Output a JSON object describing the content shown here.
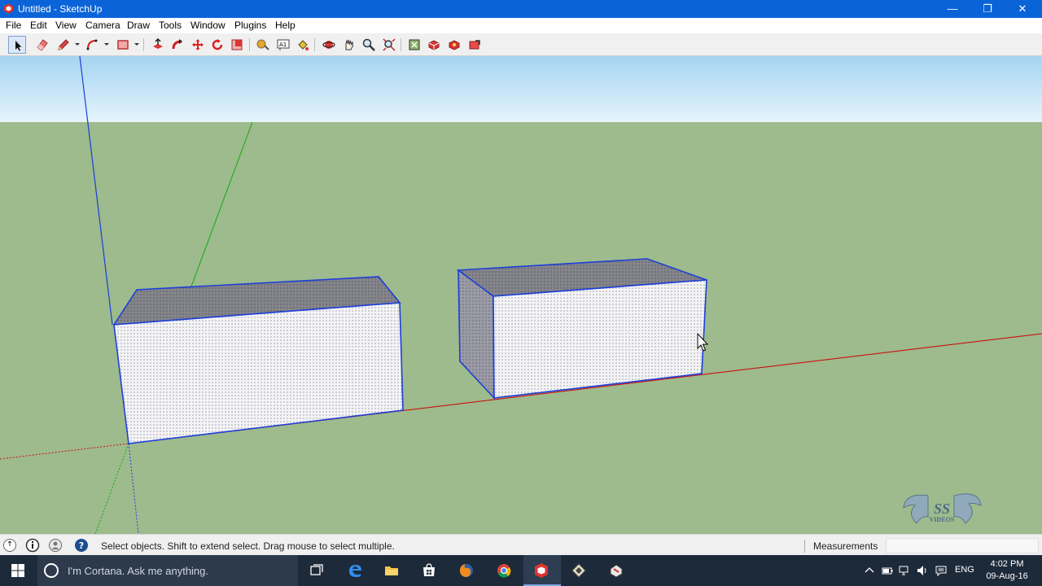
{
  "window": {
    "title": "Untitled - SketchUp",
    "controls": {
      "minimize": "—",
      "maximize": "❐",
      "close": "✕"
    }
  },
  "menu": [
    "File",
    "Edit",
    "View",
    "Camera",
    "Draw",
    "Tools",
    "Window",
    "Plugins",
    "Help"
  ],
  "toolbar": {
    "tools": [
      "select-icon",
      "eraser-icon",
      "pencil-icon",
      "arc-icon",
      "rectangle-icon",
      "push-pull-icon",
      "follow-me-icon",
      "move-icon",
      "rotate-icon",
      "scale-icon",
      "tape-measure-icon",
      "text-icon",
      "paint-bucket-icon",
      "orbit-icon",
      "pan-icon",
      "zoom-icon",
      "zoom-extents-icon",
      "previous-view-icon",
      "components-icon",
      "warehouse-icon",
      "share-model-icon",
      "extension-icon"
    ],
    "selected_tool": "select-icon"
  },
  "viewport": {
    "colors": {
      "sky": "#a5d4f2",
      "ground": "#9dbb8d",
      "edge": "#1d3fd8",
      "axis_red": "#cc1111",
      "axis_green": "#11aa11",
      "axis_blue": "#1a3fd8"
    },
    "watermark": {
      "line1": "SS",
      "line2": "VIDEOS"
    }
  },
  "status": {
    "icons": [
      "geo-location-icon",
      "info-icon",
      "credits-icon",
      "help-icon"
    ],
    "message": "Select objects. Shift to extend select. Drag mouse to select multiple.",
    "measurements_label": "Measurements",
    "measurements_value": ""
  },
  "taskbar": {
    "search_placeholder": "I'm Cortana. Ask me anything.",
    "apps": [
      "task-view-icon",
      "edge-icon",
      "file-explorer-icon",
      "store-icon",
      "firefox-icon",
      "chrome-icon",
      "sketchup-icon",
      "layout-icon",
      "style-builder-icon"
    ],
    "active_app": "sketchup-icon",
    "language": "ENG",
    "time": "4:02 PM",
    "date": "09-Aug-16"
  }
}
